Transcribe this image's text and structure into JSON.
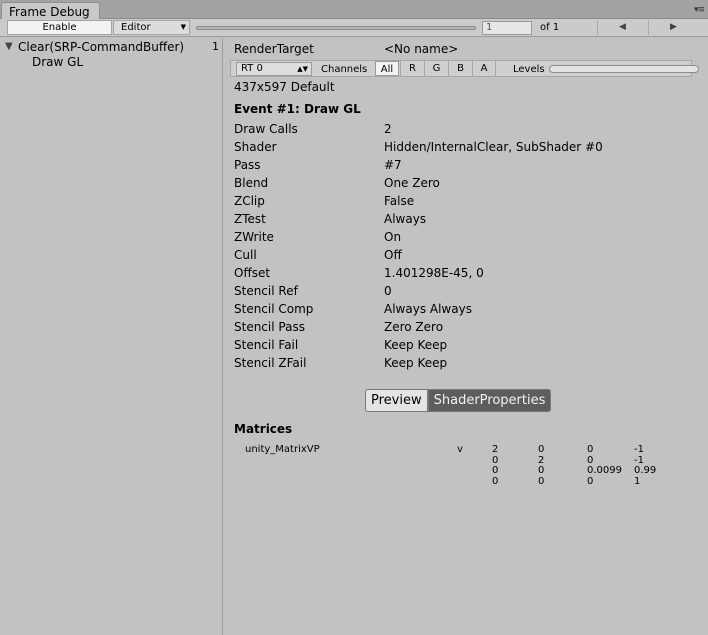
{
  "window": {
    "title": "Frame Debug",
    "menu_icon": "▾≡"
  },
  "toolbar": {
    "enable_label": "Enable",
    "editor_label": "Editor",
    "event_index": "1",
    "of_label": "of 1",
    "prev_icon": "◀",
    "next_icon": "▶"
  },
  "tree": {
    "items": [
      {
        "label": "Clear(SRP-CommandBuffer)",
        "count": "1",
        "expanded": true
      },
      {
        "label": "Draw GL"
      }
    ]
  },
  "render_target": {
    "label": "RenderTarget",
    "value": "<No name>",
    "rt_select": "RT 0",
    "channels_label": "Channels",
    "channels": [
      "All",
      "R",
      "G",
      "B",
      "A"
    ],
    "levels_label": "Levels",
    "size_text": "437x597 Default"
  },
  "event": {
    "title": "Event #1: Draw GL",
    "properties": [
      {
        "label": "Draw Calls",
        "value": "2"
      },
      {
        "label": "Shader",
        "value": "Hidden/InternalClear, SubShader #0"
      },
      {
        "label": "Pass",
        "value": "#7"
      },
      {
        "label": "Blend",
        "value": "One Zero"
      },
      {
        "label": "ZClip",
        "value": "False"
      },
      {
        "label": "ZTest",
        "value": "Always"
      },
      {
        "label": "ZWrite",
        "value": "On"
      },
      {
        "label": "Cull",
        "value": "Off"
      },
      {
        "label": "Offset",
        "value": "1.401298E-45, 0"
      },
      {
        "label": "Stencil Ref",
        "value": "0"
      },
      {
        "label": "Stencil Comp",
        "value": "Always Always"
      },
      {
        "label": "Stencil Pass",
        "value": "Zero Zero"
      },
      {
        "label": "Stencil Fail",
        "value": "Keep Keep"
      },
      {
        "label": "Stencil ZFail",
        "value": "Keep Keep"
      }
    ]
  },
  "view_toggle": {
    "preview_label": "Preview",
    "shader_props_label": "ShaderProperties"
  },
  "matrices": {
    "heading": "Matrices",
    "name": "unity_MatrixVP",
    "stage": "v",
    "rows": [
      [
        "2",
        "0",
        "0",
        "-1"
      ],
      [
        "0",
        "2",
        "0",
        "-1"
      ],
      [
        "0",
        "0",
        "0.0099",
        "0.99"
      ],
      [
        "0",
        "0",
        "0",
        "1"
      ]
    ]
  }
}
